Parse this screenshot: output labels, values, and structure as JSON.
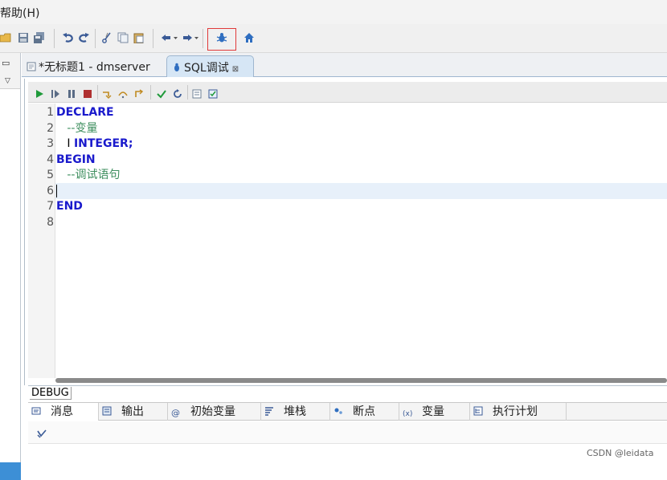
{
  "menubar": {
    "help_label": "帮助(H)"
  },
  "toolbar": {
    "icons": [
      "open-folder-icon",
      "save-icon",
      "save-all-icon",
      "undo-icon",
      "redo-icon",
      "cut-icon",
      "copy-icon",
      "paste-icon",
      "back-icon",
      "forward-icon",
      "debug-bug-icon",
      "home-icon"
    ]
  },
  "tabs": [
    {
      "label": "*无标题1 - dmserver",
      "icon": "sql-file-icon"
    },
    {
      "label": "SQL调试",
      "icon": "debug-bug-icon",
      "active": true
    }
  ],
  "debug_toolbar": {
    "icons": [
      "run-icon",
      "step-run-icon",
      "pause-icon",
      "stop-icon",
      "step-into-icon",
      "step-over-icon",
      "step-return-icon",
      "check-icon",
      "refresh-icon",
      "breakpoint-list-icon",
      "confirm-icon"
    ]
  },
  "editor": {
    "lines": [
      {
        "num": "1",
        "parts": [
          {
            "t": "DECLARE",
            "c": "kw"
          }
        ]
      },
      {
        "num": "2",
        "parts": [
          {
            "t": "   --变量",
            "c": "cm"
          }
        ]
      },
      {
        "num": "3",
        "parts": [
          {
            "t": "   I ",
            "c": "plain"
          },
          {
            "t": "INTEGER",
            "c": "kw"
          },
          {
            "t": ";",
            "c": "kw"
          }
        ]
      },
      {
        "num": "4",
        "parts": [
          {
            "t": "BEGIN",
            "c": "kw"
          }
        ]
      },
      {
        "num": "5",
        "parts": [
          {
            "t": "   --调试语句",
            "c": "cm"
          }
        ]
      },
      {
        "num": "6",
        "parts": []
      },
      {
        "num": "7",
        "parts": [
          {
            "t": "END",
            "c": "kw"
          }
        ]
      },
      {
        "num": "8",
        "parts": []
      }
    ],
    "current_line": 6
  },
  "bottom_panel": {
    "title": "DEBUG",
    "tabs": [
      {
        "label": "消息",
        "icon": "message-icon"
      },
      {
        "label": "输出",
        "icon": "output-icon"
      },
      {
        "label": "初始变量",
        "icon": "at-icon"
      },
      {
        "label": "堆栈",
        "icon": "stack-icon"
      },
      {
        "label": "断点",
        "icon": "breakpoint-icon"
      },
      {
        "label": "变量",
        "icon": "variable-icon"
      },
      {
        "label": "执行计划",
        "icon": "plan-icon"
      }
    ],
    "clear_icon": "clear-icon"
  },
  "watermark": "CSDN @leidata"
}
